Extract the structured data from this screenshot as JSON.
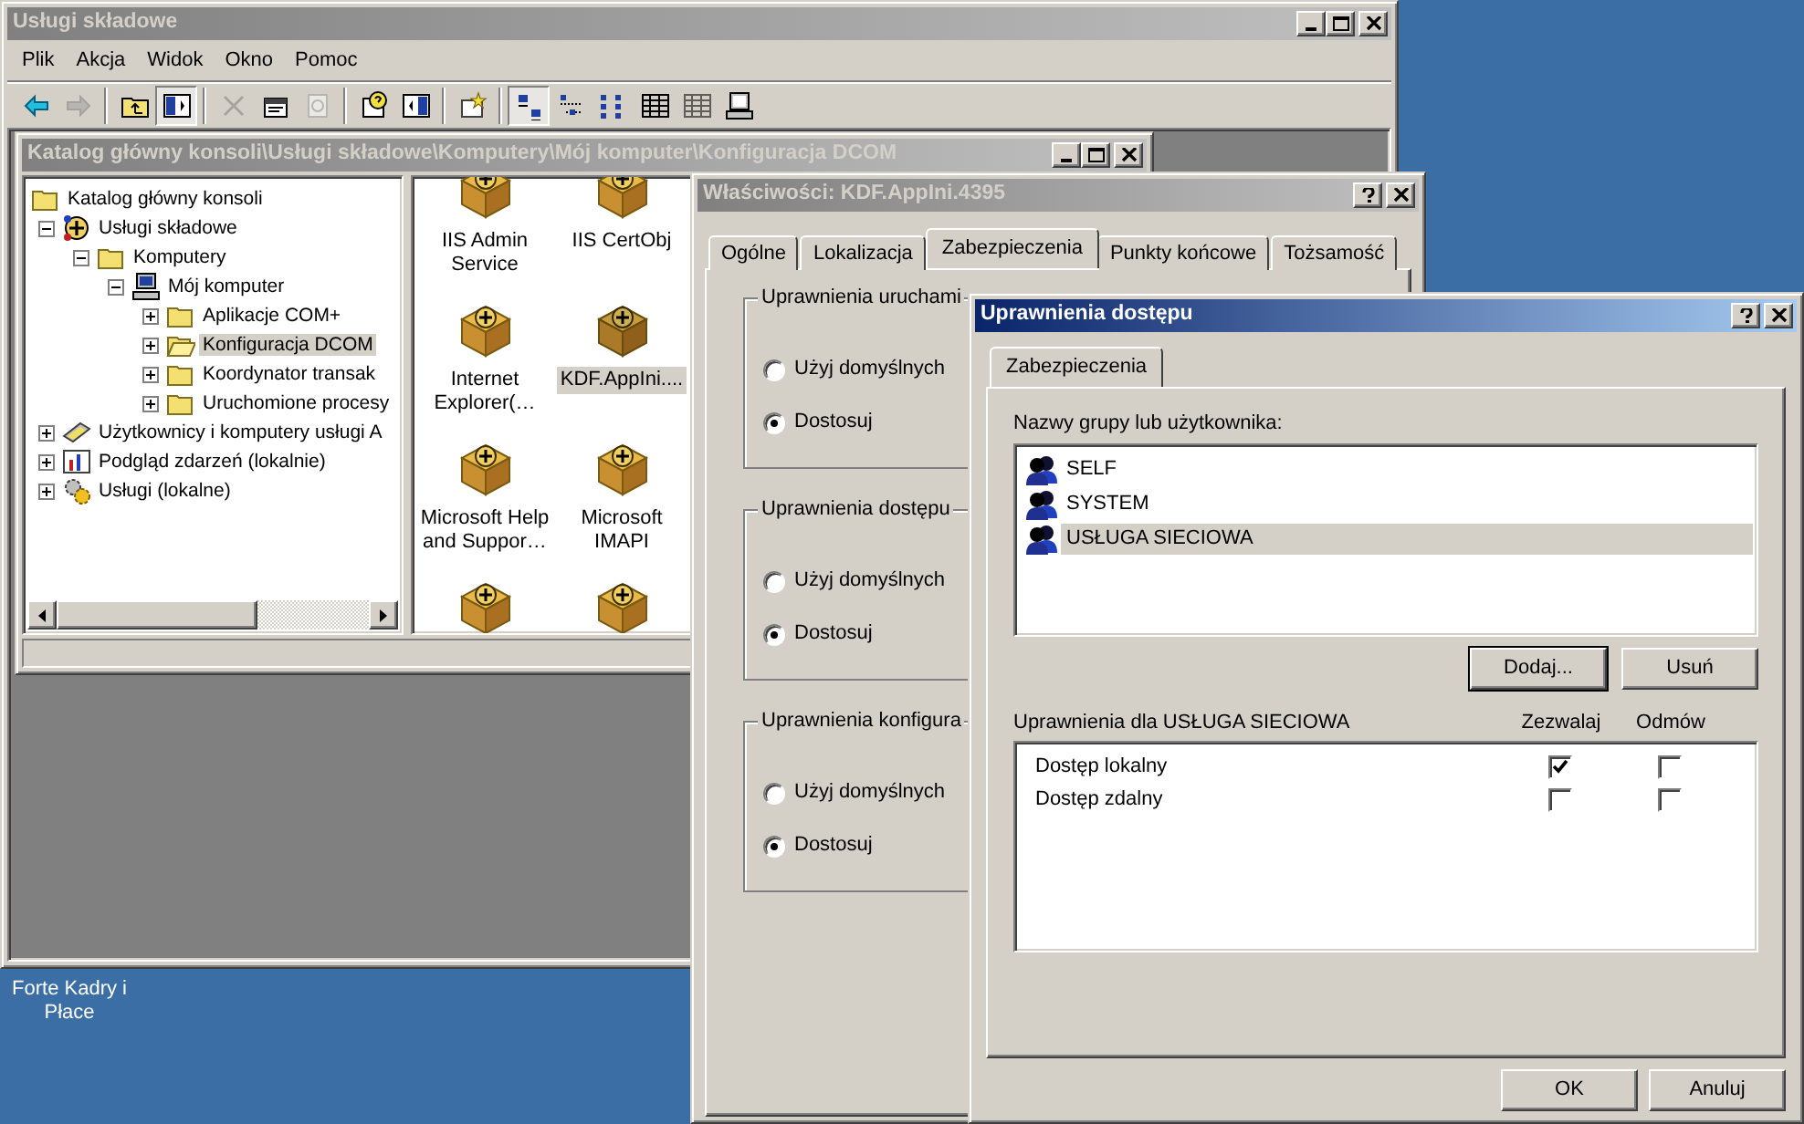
{
  "main_window": {
    "title": "Usługi składowe",
    "active": false,
    "title_buttons": [
      {
        "kind": "minimize"
      },
      {
        "kind": "maximize"
      },
      {
        "kind": "close"
      }
    ],
    "menu": [
      "Plik",
      "Akcja",
      "Widok",
      "Okno",
      "Pomoc"
    ],
    "toolbar": [
      {
        "kind": "back",
        "pressed": false,
        "disabled": false
      },
      {
        "kind": "forward",
        "pressed": false,
        "disabled": true
      },
      {
        "kind": "separator"
      },
      {
        "kind": "up",
        "pressed": false,
        "disabled": false
      },
      {
        "kind": "tree",
        "pressed": true,
        "disabled": false
      },
      {
        "kind": "separator"
      },
      {
        "kind": "delete",
        "pressed": false,
        "disabled": true
      },
      {
        "kind": "properties",
        "pressed": false,
        "disabled": false
      },
      {
        "kind": "refresh",
        "pressed": false,
        "disabled": true
      },
      {
        "kind": "separator"
      },
      {
        "kind": "help",
        "pressed": false,
        "disabled": false
      },
      {
        "kind": "pane",
        "pressed": false,
        "disabled": false
      },
      {
        "kind": "separator"
      },
      {
        "kind": "newwindow",
        "pressed": false,
        "disabled": false
      },
      {
        "kind": "separator"
      },
      {
        "kind": "largeicons",
        "pressed": true,
        "disabled": false
      },
      {
        "kind": "smallicons",
        "pressed": false,
        "disabled": false
      },
      {
        "kind": "list",
        "pressed": false,
        "disabled": false
      },
      {
        "kind": "details",
        "pressed": false,
        "disabled": false
      },
      {
        "kind": "details",
        "pressed": false,
        "disabled": true
      },
      {
        "kind": "computer",
        "pressed": false,
        "disabled": false
      }
    ],
    "child_window": {
      "title": "Katalog główny konsoli\\Usługi składowe\\Komputery\\Mój komputer\\Konfiguracja DCOM",
      "active": false,
      "title_buttons": [
        {
          "kind": "minimize"
        },
        {
          "kind": "maximize"
        },
        {
          "kind": "close"
        }
      ],
      "tree": [
        {
          "label": "Katalog główny konsoli",
          "kind": "folder",
          "selected": false,
          "children": [
            {
              "label": "Usługi składowe",
              "kind": "component",
              "expanded": true,
              "selected": false,
              "children": [
                {
                  "label": "Komputery",
                  "kind": "folder",
                  "expanded": true,
                  "selected": false,
                  "children": [
                    {
                      "label": "Mój komputer",
                      "kind": "computer",
                      "expanded": true,
                      "selected": false,
                      "children": [
                        {
                          "label": "Aplikacje COM+",
                          "kind": "folder",
                          "expanded": false,
                          "selected": false
                        },
                        {
                          "label": "Konfiguracja DCOM",
                          "kind": "openfolder",
                          "expanded": false,
                          "selected": true
                        },
                        {
                          "label": "Koordynator transak",
                          "kind": "folder",
                          "expanded": false,
                          "selected": false
                        },
                        {
                          "label": "Uruchomione procesy",
                          "kind": "folder",
                          "expanded": false,
                          "selected": false
                        }
                      ]
                    }
                  ]
                }
              ]
            },
            {
              "label": "Użytkownicy i komputery usługi A",
              "kind": "users",
              "expanded": false,
              "selected": false
            },
            {
              "label": "Podgląd zdarzeń (lokalnie)",
              "kind": "events",
              "expanded": false,
              "selected": false
            },
            {
              "label": "Usługi (lokalne)",
              "kind": "services",
              "expanded": false,
              "selected": false
            }
          ]
        }
      ],
      "icons": [
        {
          "label": "IIS Admin Service",
          "selected": false
        },
        {
          "label": "IIS CertObj",
          "selected": false
        },
        {
          "label": "Internet Explorer(…",
          "selected": false
        },
        {
          "label": "KDF.AppIni....",
          "selected": true
        },
        {
          "label": "Microsoft Help and Suppor…",
          "selected": false
        },
        {
          "label": "Microsoft IMAPI",
          "selected": false
        },
        {
          "selected": false
        },
        {
          "selected": false
        }
      ]
    }
  },
  "properties_window": {
    "title": "Właściwości: KDF.AppIni.4395",
    "active": false,
    "title_buttons": [
      {
        "kind": "help"
      },
      {
        "kind": "close"
      }
    ],
    "tabs": [
      {
        "label": "Ogólne",
        "selected": false
      },
      {
        "label": "Lokalizacja",
        "selected": false
      },
      {
        "label": "Zabezpieczenia",
        "selected": true
      },
      {
        "label": "Punkty końcowe",
        "selected": false
      },
      {
        "label": "Tożsamość",
        "selected": false
      }
    ],
    "groups": [
      {
        "title": "Uprawnienia uruchami",
        "options": [
          {
            "label": "Użyj domyślnych",
            "selected": false
          },
          {
            "label": "Dostosuj",
            "selected": true
          }
        ]
      },
      {
        "title": "Uprawnienia dostępu",
        "options": [
          {
            "label": "Użyj domyślnych",
            "selected": false
          },
          {
            "label": "Dostosuj",
            "selected": true
          }
        ]
      },
      {
        "title": "Uprawnienia konfigura",
        "options": [
          {
            "label": "Użyj domyślnych",
            "selected": false
          },
          {
            "label": "Dostosuj",
            "selected": true
          }
        ]
      }
    ]
  },
  "access_dialog": {
    "title": "Uprawnienia dostępu",
    "active": true,
    "title_buttons": [
      {
        "kind": "help"
      },
      {
        "kind": "close"
      }
    ],
    "tabs": [
      {
        "label": "Zabezpieczenia",
        "selected": true
      }
    ],
    "users_label": "Nazwy grupy lub użytkownika:",
    "users": [
      {
        "name": "SELF",
        "selected": false
      },
      {
        "name": "SYSTEM",
        "selected": false
      },
      {
        "name": "USŁUGA SIECIOWA",
        "selected": true
      }
    ],
    "user_buttons": [
      {
        "label": "Dodaj...",
        "default": true
      },
      {
        "label": "Usuń",
        "default": false
      }
    ],
    "permissions_label": "Uprawnienia dla USŁUGA SIECIOWA",
    "columns": [
      "Zezwalaj",
      "Odmów"
    ],
    "permissions": [
      {
        "name": "Dostęp lokalny",
        "allow": true,
        "deny": false
      },
      {
        "name": "Dostęp zdalny",
        "allow": false,
        "deny": false
      }
    ],
    "buttons": [
      "OK",
      "Anuluj"
    ]
  },
  "desktop": {
    "icon_label": "Forte Kadry i Płace"
  }
}
